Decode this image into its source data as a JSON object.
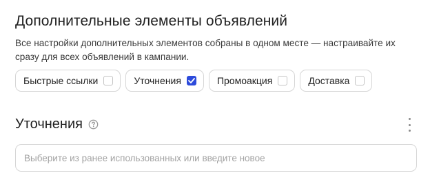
{
  "section": {
    "title": "Дополнительные элементы объявлений",
    "description": "Все настройки дополнительных элементов собраны в одном месте — настраивайте их сразу для всех объявлений в кампании."
  },
  "chips": [
    {
      "label": "Быстрые ссылки",
      "checked": false
    },
    {
      "label": "Уточнения",
      "checked": true
    },
    {
      "label": "Промоакция",
      "checked": false
    },
    {
      "label": "Доставка",
      "checked": false
    }
  ],
  "subsection": {
    "title": "Уточнения",
    "help_icon": "question-circle-icon",
    "more_icon": "kebab-menu-icon"
  },
  "input": {
    "value": "",
    "placeholder": "Выберите из ранее использованных или введите новое"
  },
  "colors": {
    "accent": "#2d4bdb",
    "border": "#d6d6d6",
    "text": "#1f1f1f",
    "placeholder": "#a3a3a3"
  }
}
